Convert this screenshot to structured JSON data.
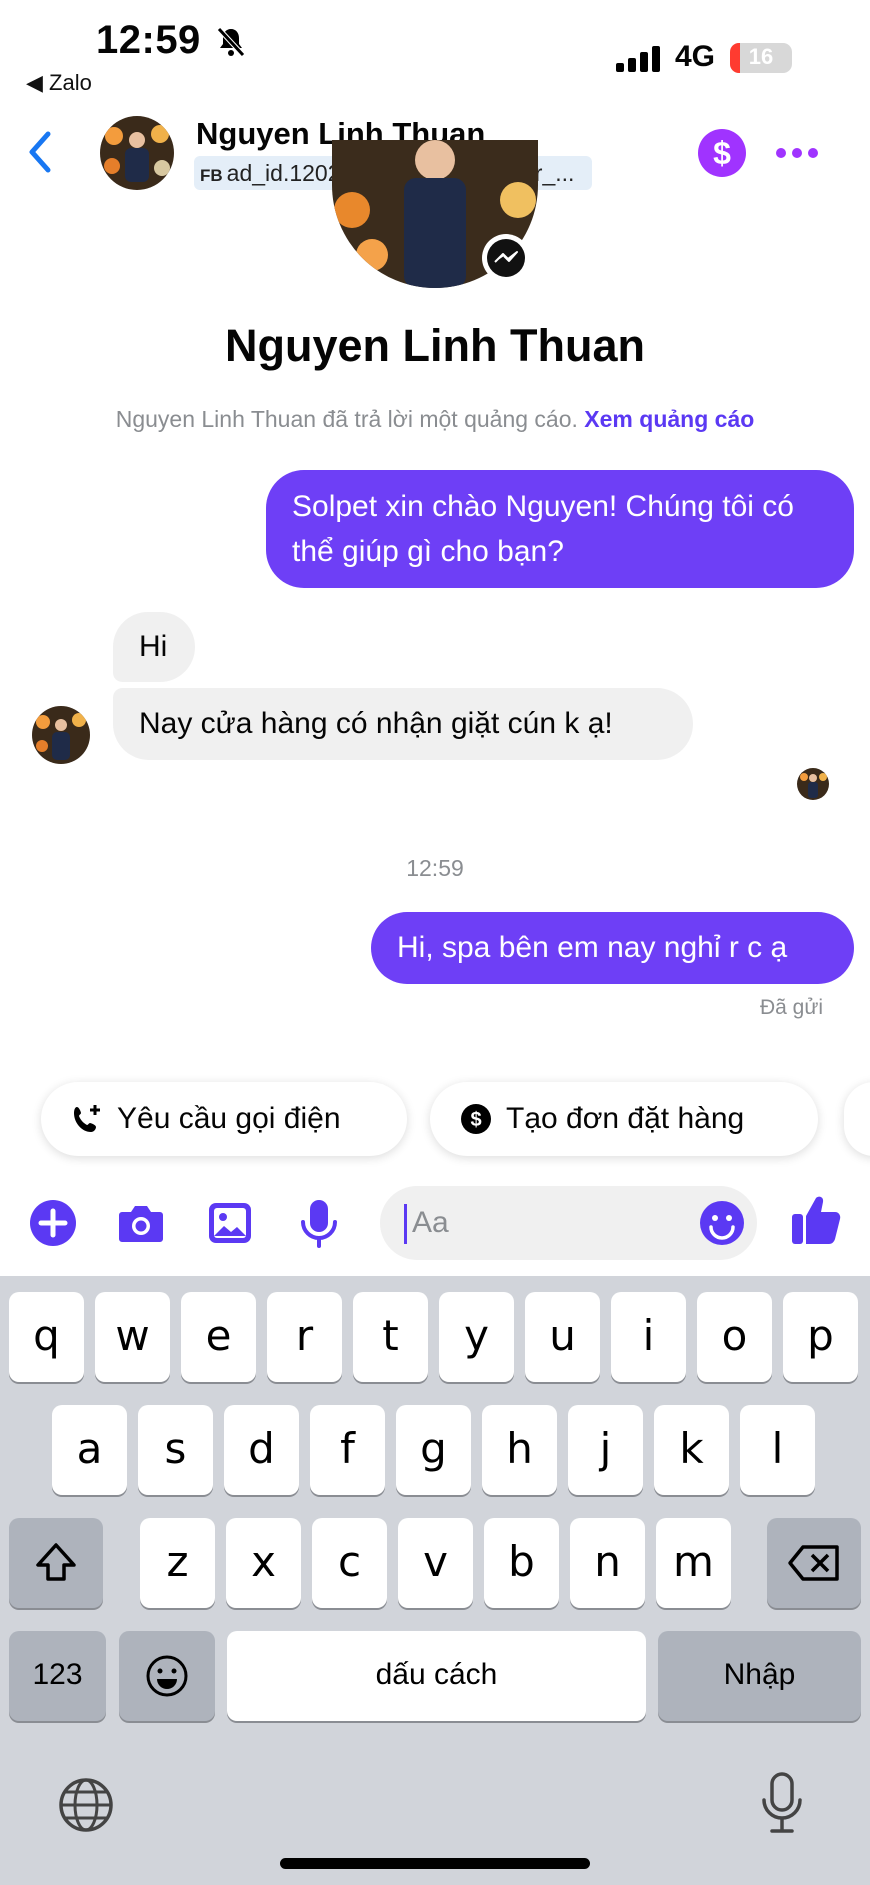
{
  "status_bar": {
    "time": "12:59",
    "back_app": "◀ Zalo",
    "network": "4G",
    "battery": "16",
    "battery_level": 0.16
  },
  "header": {
    "name": "Nguyen Linh Thuan",
    "tags": [
      {
        "prefix": "FB",
        "text": "ad_id.12021..."
      },
      {
        "prefix": "FB",
        "text": "messenger_..."
      }
    ],
    "dollar_label": "$"
  },
  "profile": {
    "name": "Nguyen Linh Thuan",
    "ad_note": "Nguyen Linh Thuan đã trả lời một quảng cáo.",
    "ad_link": "Xem quảng cáo"
  },
  "messages": [
    {
      "direction": "out",
      "text": "Solpet xin chào Nguyen! Chúng tôi có thể giúp gì cho bạn?"
    },
    {
      "direction": "in",
      "text": "Hi"
    },
    {
      "direction": "in",
      "text": "Nay cửa hàng có nhận giặt cún k ạ!"
    },
    {
      "direction": "out",
      "text": "Hi, spa bên em nay nghỉ r c ạ"
    }
  ],
  "timestamp": "12:59",
  "sent_status": "Đã gửi",
  "quick_replies": [
    {
      "label": "Yêu cầu gọi điện",
      "icon": "phone-plus-icon"
    },
    {
      "label": "Tạo đơn đặt hàng",
      "icon": "dollar-circle-icon"
    }
  ],
  "composer": {
    "placeholder": "Aa",
    "value": ""
  },
  "keyboard": {
    "row1": [
      "q",
      "w",
      "e",
      "r",
      "t",
      "y",
      "u",
      "i",
      "o",
      "p"
    ],
    "row2": [
      "a",
      "s",
      "d",
      "f",
      "g",
      "h",
      "j",
      "k",
      "l"
    ],
    "row3": [
      "z",
      "x",
      "c",
      "v",
      "b",
      "n",
      "m"
    ],
    "numbers_label": "123",
    "space_label": "dấu cách",
    "return_label": "Nhập"
  },
  "colors": {
    "accent": "#5b39f3",
    "outgoing_bubble": "#6e3ff6",
    "incoming_bubble": "#f0f0f0",
    "dollar_button": "#a033ff",
    "keyboard_bg": "#d1d4da"
  }
}
